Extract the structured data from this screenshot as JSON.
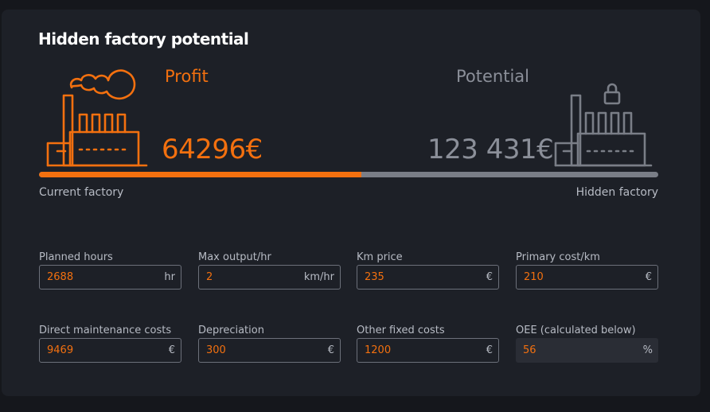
{
  "card": {
    "title": "Hidden factory potential",
    "profit": {
      "label": "Profit",
      "value": "64296€"
    },
    "potential": {
      "label": "Potential",
      "value": "123 431€"
    },
    "progress": {
      "fraction": 0.52
    },
    "caption_left": "Current factory",
    "caption_right": "Hidden factory"
  },
  "fields": [
    {
      "label": "Planned hours",
      "value": "2688",
      "unit": "hr"
    },
    {
      "label": "Max output/hr",
      "value": "2",
      "unit": "km/hr"
    },
    {
      "label": "Km price",
      "value": "235",
      "unit": "€"
    },
    {
      "label": "Primary cost/km",
      "value": "210",
      "unit": "€"
    },
    {
      "label": "Direct maintenance costs",
      "value": "9469",
      "unit": "€"
    },
    {
      "label": "Depreciation",
      "value": "300",
      "unit": "€"
    },
    {
      "label": "Other fixed costs",
      "value": "1200",
      "unit": "€"
    },
    {
      "label": "OEE (calculated below)",
      "value": "56",
      "unit": "%"
    }
  ],
  "icons": {
    "factory_left": "factory-smoke-icon",
    "factory_right": "factory-locked-icon"
  },
  "colors": {
    "accent": "#f3700f",
    "muted": "#8b8f99"
  }
}
